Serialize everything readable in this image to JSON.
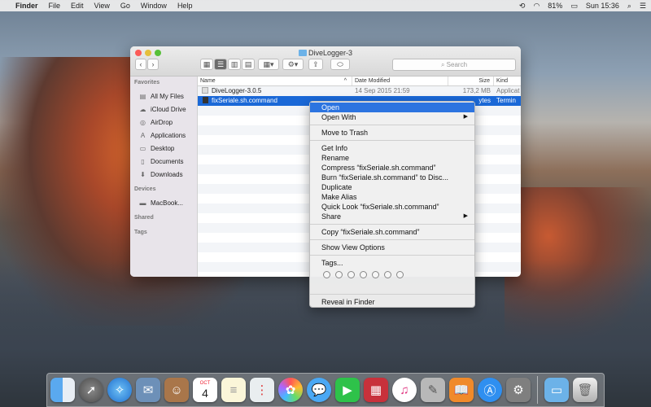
{
  "menubar": {
    "apple": "",
    "app": "Finder",
    "items": [
      "File",
      "Edit",
      "View",
      "Go",
      "Window",
      "Help"
    ],
    "battery": "81%",
    "clock": "Sun 15:36"
  },
  "window": {
    "title": "DiveLogger-3",
    "search_placeholder": "Search"
  },
  "sidebar": {
    "favorites_header": "Favorites",
    "favorites": [
      {
        "label": "All My Files",
        "icon": "all-files-icon"
      },
      {
        "label": "iCloud Drive",
        "icon": "cloud-icon"
      },
      {
        "label": "AirDrop",
        "icon": "airdrop-icon"
      },
      {
        "label": "Applications",
        "icon": "applications-icon"
      },
      {
        "label": "Desktop",
        "icon": "desktop-icon"
      },
      {
        "label": "Documents",
        "icon": "documents-icon"
      },
      {
        "label": "Downloads",
        "icon": "downloads-icon"
      }
    ],
    "devices_header": "Devices",
    "devices": [
      {
        "label": "MacBook...",
        "icon": "laptop-icon"
      }
    ],
    "shared_header": "Shared",
    "tags_header": "Tags"
  },
  "columns": {
    "name": "Name",
    "date": "Date Modified",
    "size": "Size",
    "kind": "Kind"
  },
  "files": [
    {
      "name": "DiveLogger-3.0.5",
      "date": "14 Sep 2015 21:59",
      "size": "173,2 MB",
      "kind": "Applicat"
    },
    {
      "name": "fixSeriale.sh.command",
      "date": "",
      "size": "ytes",
      "kind": "Termin"
    }
  ],
  "context_menu": {
    "open": "Open",
    "open_with": "Open With",
    "move_to_trash": "Move to Trash",
    "get_info": "Get Info",
    "rename": "Rename",
    "compress": "Compress “fixSeriale.sh.command”",
    "burn": "Burn “fixSeriale.sh.command” to Disc...",
    "duplicate": "Duplicate",
    "make_alias": "Make Alias",
    "quick_look": "Quick Look “fixSeriale.sh.command”",
    "share": "Share",
    "copy": "Copy “fixSeriale.sh.command”",
    "show_view_options": "Show View Options",
    "tags": "Tags...",
    "reveal": "Reveal in Finder"
  },
  "dock": {
    "calendar_month": "OCT",
    "calendar_day": "4"
  },
  "colors": {
    "selection": "#1a68d7",
    "menu_highlight": "#2c74e0",
    "folder": "#6cb2e8"
  }
}
